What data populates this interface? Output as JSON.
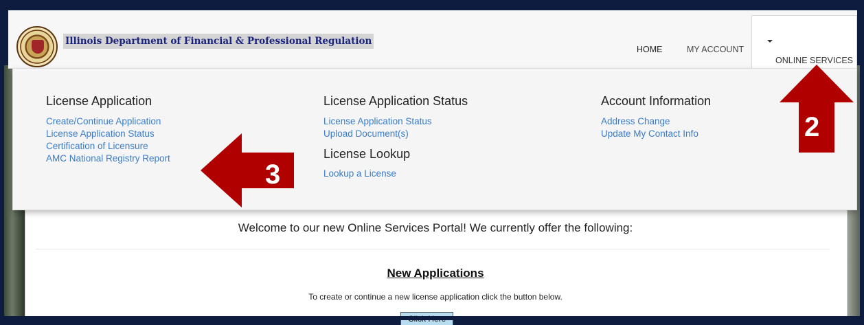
{
  "header": {
    "brand_title": "Illinois Department of Financial & Professional Regulation",
    "nav": {
      "home": "HOME",
      "my_account": "MY ACCOUNT",
      "online_services": "ONLINE SERVICES"
    }
  },
  "dropdown": {
    "license_application": {
      "heading": "License Application",
      "links": [
        "Create/Continue Application",
        "License Application Status",
        "Certification of Licensure",
        "AMC National Registry Report"
      ]
    },
    "license_application_status": {
      "heading": "License Application Status",
      "links": [
        "License Application Status",
        "Upload Document(s)"
      ]
    },
    "license_lookup": {
      "heading": "License Lookup",
      "links": [
        "Lookup a License"
      ]
    },
    "account_information": {
      "heading": "Account Information",
      "links": [
        "Address Change",
        "Update My Contact Info"
      ]
    }
  },
  "main": {
    "welcome": "Welcome to our new Online Services Portal! We currently offer the following:",
    "section_title": "New Applications",
    "instructions": "To create or continue a new license application click the button below.",
    "button_label": "Click Here"
  },
  "annotations": {
    "arrow_up_number": "2",
    "arrow_left_number": "3",
    "arrow_color": "#b00000"
  },
  "colors": {
    "link": "#3a7bc8",
    "brand_text": "#1a237e",
    "frame": "#0d1c3f"
  }
}
